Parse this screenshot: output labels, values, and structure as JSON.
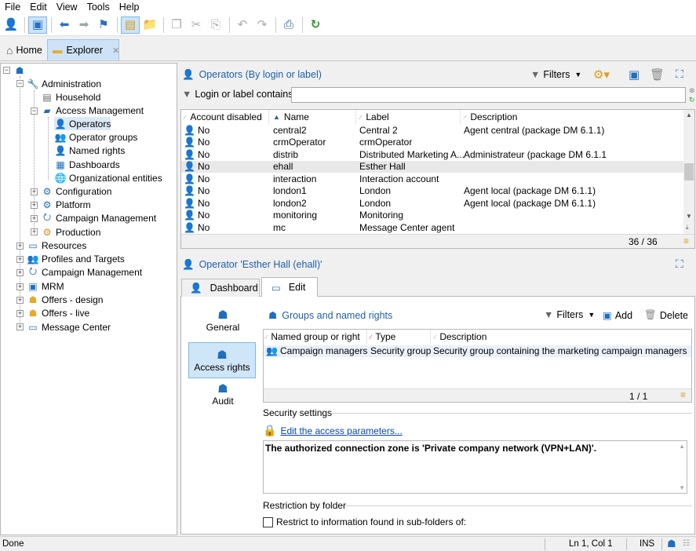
{
  "menu": [
    "File",
    "Edit",
    "View",
    "Tools",
    "Help"
  ],
  "tabs": {
    "home": "Home",
    "explorer": "Explorer"
  },
  "tree": {
    "root": "",
    "administration": "Administration",
    "household": "Household",
    "access_management": "Access Management",
    "operators": "Operators",
    "operator_groups": "Operator groups",
    "named_rights": "Named rights",
    "dashboards": "Dashboards",
    "organizational_entities": "Organizational entities",
    "configuration": "Configuration",
    "platform": "Platform",
    "campaign_management_admin": "Campaign Management",
    "production": "Production",
    "resources": "Resources",
    "profiles_targets": "Profiles and Targets",
    "campaign_management": "Campaign Management",
    "mrm": "MRM",
    "offers_design": "Offers - design",
    "offers_live": "Offers - live",
    "message_center": "Message Center"
  },
  "operators_panel": {
    "title": "Operators (By login or label)",
    "filters": "Filters",
    "search_label": "Login or label contains:",
    "search_value": "",
    "columns": [
      "Account disabled",
      "Name",
      "Label",
      "Description"
    ],
    "rows": [
      {
        "disabled": "No",
        "name": "central2",
        "label": "Central 2",
        "description": "Agent central (package DM 6.1.1)"
      },
      {
        "disabled": "No",
        "name": "crmOperator",
        "label": "crmOperator",
        "description": ""
      },
      {
        "disabled": "No",
        "name": "distrib",
        "label": "Distributed Marketing A...",
        "description": "Administrateur (package DM 6.1.1"
      },
      {
        "disabled": "No",
        "name": "ehall",
        "label": "Esther Hall",
        "description": ""
      },
      {
        "disabled": "No",
        "name": "interaction",
        "label": "Interaction account",
        "description": ""
      },
      {
        "disabled": "No",
        "name": "london1",
        "label": "London",
        "description": "Agent local (package DM 6.1.1)"
      },
      {
        "disabled": "No",
        "name": "london2",
        "label": "London",
        "description": "Agent local (package DM 6.1.1)"
      },
      {
        "disabled": "No",
        "name": "monitoring",
        "label": "Monitoring",
        "description": ""
      },
      {
        "disabled": "No",
        "name": "mc",
        "label": "Message Center agent",
        "description": ""
      }
    ],
    "count": "36 / 36"
  },
  "detail": {
    "title": "Operator 'Esther Hall (ehall)'",
    "tabs": [
      "Dashboard",
      "Edit"
    ],
    "side": [
      "General",
      "Access rights",
      "Audit"
    ],
    "groups_title": "Groups and named rights",
    "filters": "Filters",
    "add": "Add",
    "delete": "Delete",
    "columns": [
      "Named group or right",
      "Type",
      "Description"
    ],
    "rows": [
      {
        "name": "Campaign managers",
        "type": "Security group",
        "description": "Security group containing the marketing campaign managers"
      }
    ],
    "count": "1 / 1",
    "security_settings": "Security settings",
    "edit_access": "Edit the access parameters...",
    "zone_text": "The authorized connection zone is 'Private company network (VPN+LAN)'.",
    "restriction": "Restriction by folder",
    "restrict_check": "Restrict to information found in sub-folders of:"
  },
  "status": {
    "left": "Done",
    "pos": "Ln 1, Col 1",
    "mode": "INS"
  }
}
